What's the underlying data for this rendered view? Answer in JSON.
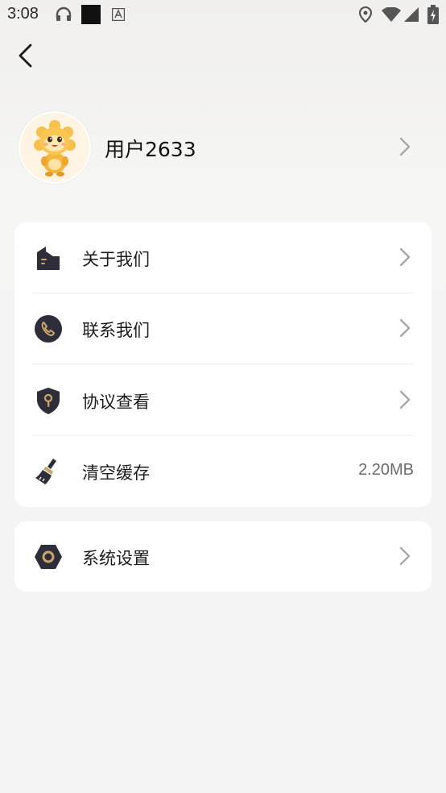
{
  "status_bar": {
    "time": "3:08"
  },
  "profile": {
    "username": "用户2633"
  },
  "menu": {
    "items": [
      {
        "label": "关于我们",
        "icon": "building-icon"
      },
      {
        "label": "联系我们",
        "icon": "phone-icon"
      },
      {
        "label": "协议查看",
        "icon": "shield-lock-icon"
      },
      {
        "label": "清空缓存",
        "icon": "broom-icon",
        "value": "2.20MB"
      }
    ]
  },
  "settings": {
    "label": "系统设置",
    "icon": "hexagon-gear-icon"
  },
  "colors": {
    "icon_dark": "#2e2d3a",
    "icon_accent": "#c9a46b",
    "chevron": "#a8a8a8"
  }
}
